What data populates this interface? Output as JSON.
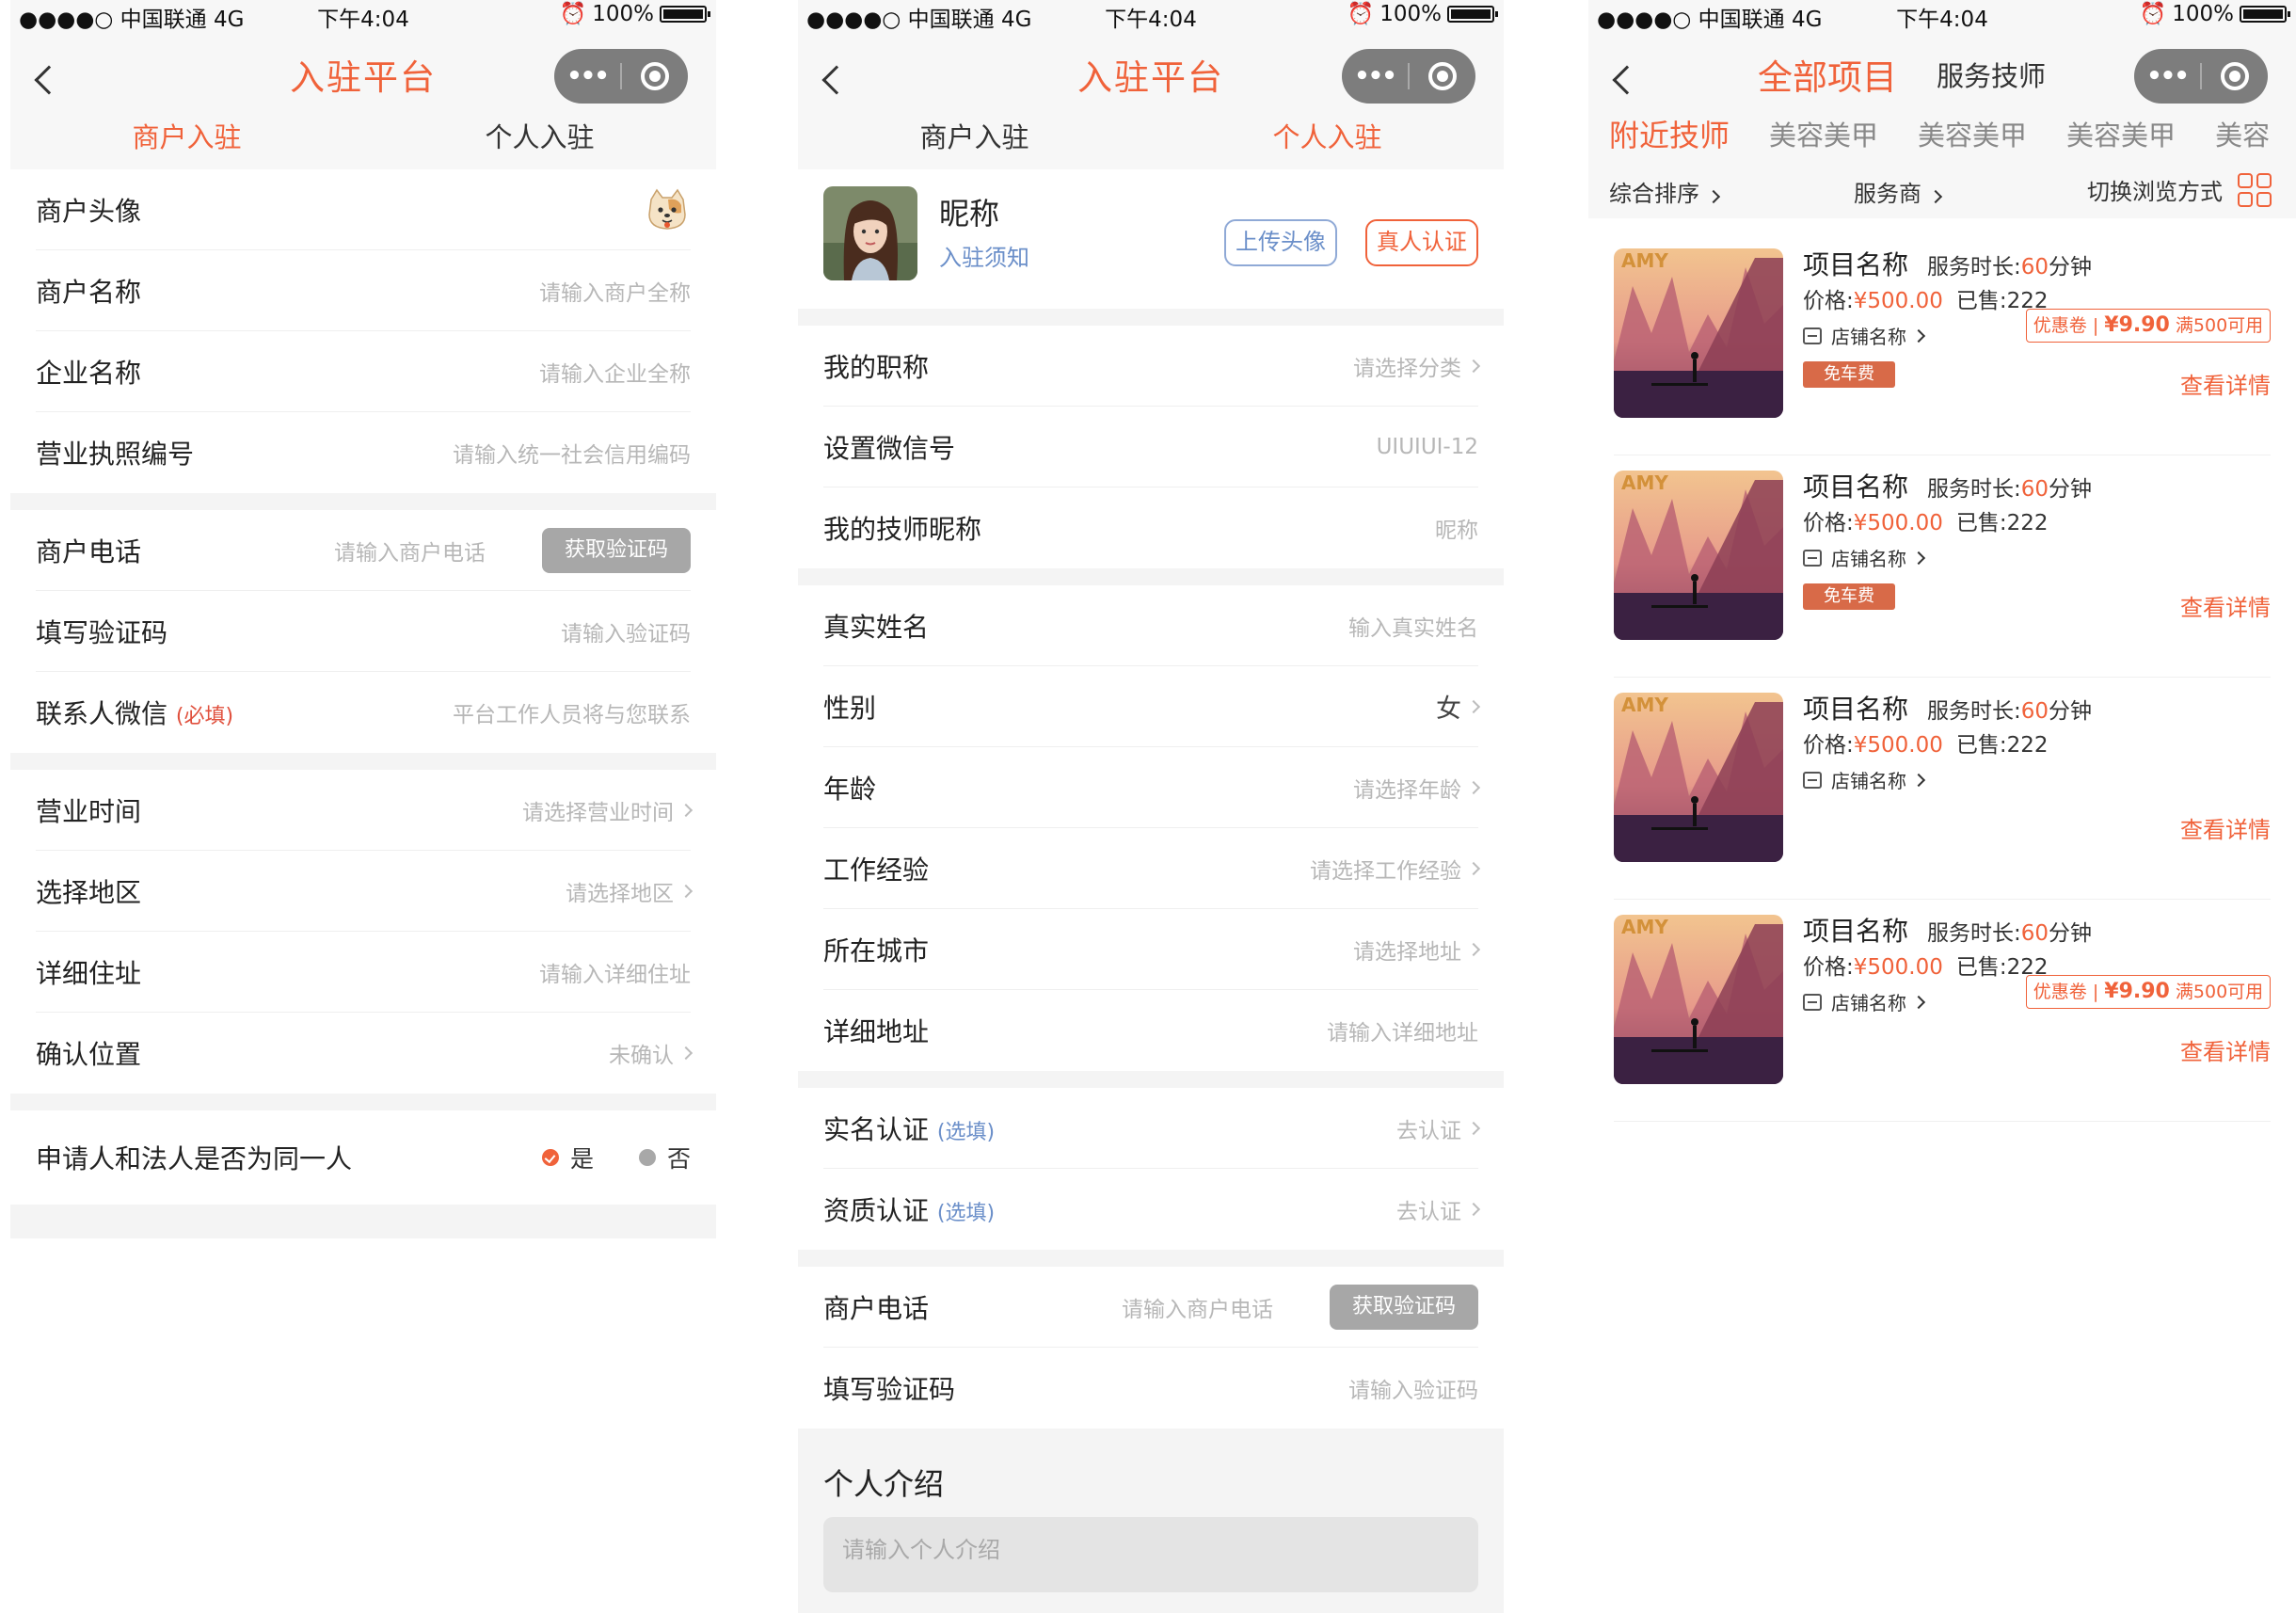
{
  "status_bar": {
    "carrier": "●●●●○ 中国联通 4G",
    "time": "下午4:04",
    "battery_pct": "100%"
  },
  "colors": {
    "accent": "#f0623a",
    "link_blue": "#6b8fc9",
    "capsule": "#7d7d7d",
    "gray_button": "#a7a7a7"
  },
  "screen1": {
    "title": "入驻平台",
    "tabs": [
      {
        "label": "商户入驻",
        "active": true
      },
      {
        "label": "个人入驻",
        "active": false
      }
    ],
    "rows": {
      "avatar": {
        "label": "商户头像",
        "icon": "cat-avatar-icon"
      },
      "merchant_name": {
        "label": "商户名称",
        "placeholder": "请输入商户全称"
      },
      "company_name": {
        "label": "企业名称",
        "placeholder": "请输入企业全称"
      },
      "license_no": {
        "label": "营业执照编号",
        "placeholder": "请输入统一社会信用编码"
      },
      "phone": {
        "label": "商户电话",
        "placeholder": "请输入商户电话",
        "button": "获取验证码"
      },
      "code": {
        "label": "填写验证码",
        "placeholder": "请输入验证码"
      },
      "wechat": {
        "label": "联系人微信",
        "required": "(必填)",
        "placeholder": "平台工作人员将与您联系"
      },
      "hours": {
        "label": "营业时间",
        "placeholder": "请选择营业时间"
      },
      "region": {
        "label": "选择地区",
        "placeholder": "请选择地区"
      },
      "address": {
        "label": "详细住址",
        "placeholder": "请输入详细住址"
      },
      "location": {
        "label": "确认位置",
        "value": "未确认"
      },
      "same_person": {
        "label": "申请人和法人是否为同一人",
        "yes": "是",
        "no": "否",
        "selected": "是"
      }
    }
  },
  "screen2": {
    "title": "入驻平台",
    "tabs": [
      {
        "label": "商户入驻",
        "active": false
      },
      {
        "label": "个人入驻",
        "active": true
      }
    ],
    "profile": {
      "nickname": "昵称",
      "notice": "入驻须知",
      "upload": "上传头像",
      "verify": "真人认证"
    },
    "rows": {
      "job_title": {
        "label": "我的职称",
        "placeholder": "请选择分类"
      },
      "wechat_id": {
        "label": "设置微信号",
        "value": "UIUIUI-12"
      },
      "tech_nick": {
        "label": "我的技师昵称",
        "placeholder": "昵称"
      },
      "real_name": {
        "label": "真实姓名",
        "placeholder": "输入真实姓名"
      },
      "gender": {
        "label": "性别",
        "value": "女"
      },
      "age": {
        "label": "年龄",
        "placeholder": "请选择年龄"
      },
      "experience": {
        "label": "工作经验",
        "placeholder": "请选择工作经验"
      },
      "city": {
        "label": "所在城市",
        "placeholder": "请选择地址"
      },
      "address": {
        "label": "详细地址",
        "placeholder": "请输入详细地址"
      },
      "realname_cert": {
        "label": "实名认证",
        "optional": "(选填)",
        "value": "去认证"
      },
      "qual_cert": {
        "label": "资质认证",
        "optional": "(选填)",
        "value": "去认证"
      },
      "phone": {
        "label": "商户电话",
        "placeholder": "请输入商户电话",
        "button": "获取验证码"
      },
      "code": {
        "label": "填写验证码",
        "placeholder": "请输入验证码"
      }
    },
    "intro": {
      "title": "个人介绍",
      "placeholder": "请输入个人介绍"
    }
  },
  "screen3": {
    "title": "全部项目",
    "subtitle": "服务技师",
    "categories": [
      {
        "label": "附近技师",
        "active": true
      },
      {
        "label": "美容美甲"
      },
      {
        "label": "美容美甲"
      },
      {
        "label": "美容美甲"
      },
      {
        "label": "美容"
      }
    ],
    "sort": {
      "overall": "综合排序",
      "provider": "服务商",
      "switch_view": "切换浏览方式"
    },
    "items": [
      {
        "name": "项目名称",
        "duration_label": "服务时长:",
        "duration_value": "60",
        "duration_unit": "分钟",
        "price_label": "价格:",
        "price": "¥500.00",
        "sold": "已售:222",
        "store": "店铺名称",
        "coupon": {
          "label": "优惠卷",
          "amount": "¥9.90",
          "cond": "满500可用"
        },
        "free_tag": "免车费",
        "detail": "查看详情",
        "thumb_text": "AMY"
      },
      {
        "name": "项目名称",
        "duration_label": "服务时长:",
        "duration_value": "60",
        "duration_unit": "分钟",
        "price_label": "价格:",
        "price": "¥500.00",
        "sold": "已售:222",
        "store": "店铺名称",
        "coupon": null,
        "free_tag": "免车费",
        "detail": "查看详情",
        "thumb_text": "AMY"
      },
      {
        "name": "项目名称",
        "duration_label": "服务时长:",
        "duration_value": "60",
        "duration_unit": "分钟",
        "price_label": "价格:",
        "price": "¥500.00",
        "sold": "已售:222",
        "store": "店铺名称",
        "coupon": null,
        "free_tag": null,
        "detail": "查看详情",
        "thumb_text": "AMY"
      },
      {
        "name": "项目名称",
        "duration_label": "服务时长:",
        "duration_value": "60",
        "duration_unit": "分钟",
        "price_label": "价格:",
        "price": "¥500.00",
        "sold": "已售:222",
        "store": "店铺名称",
        "coupon": {
          "label": "优惠卷",
          "amount": "¥9.90",
          "cond": "满500可用"
        },
        "free_tag": null,
        "detail": "查看详情",
        "thumb_text": "AMY"
      }
    ]
  }
}
